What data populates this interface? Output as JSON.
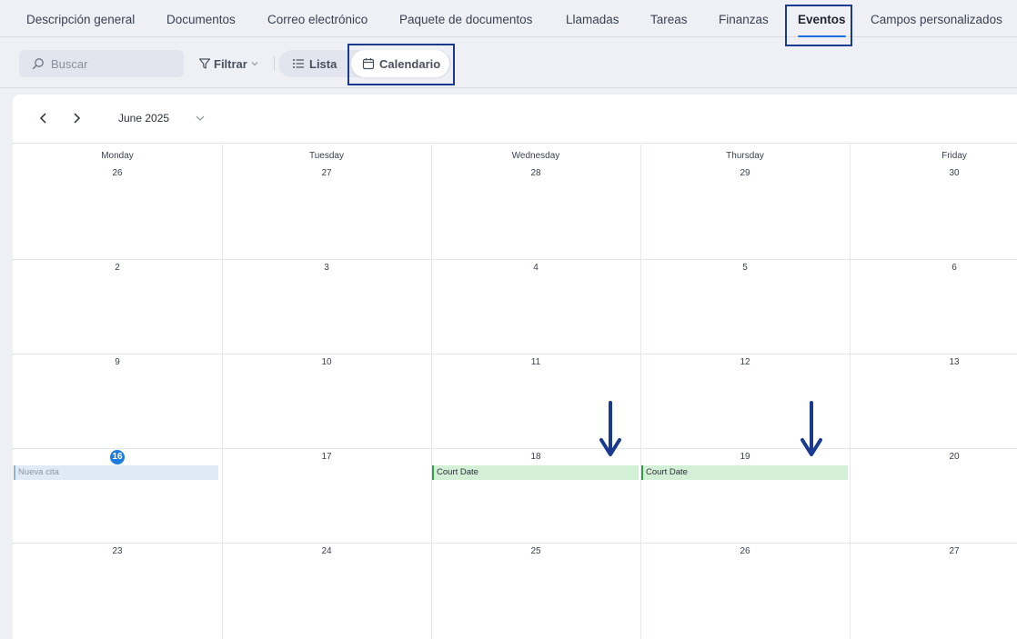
{
  "tabs": [
    {
      "label": "Descripción general",
      "active": false
    },
    {
      "label": "Documentos",
      "active": false
    },
    {
      "label": "Correo electrónico",
      "active": false
    },
    {
      "label": "Paquete de documentos",
      "active": false
    },
    {
      "label": "Llamadas",
      "active": false
    },
    {
      "label": "Tareas",
      "active": false
    },
    {
      "label": "Finanzas",
      "active": false
    },
    {
      "label": "Eventos",
      "active": true
    },
    {
      "label": "Campos personalizados",
      "active": false
    }
  ],
  "toolbar": {
    "search_placeholder": "Buscar",
    "filter_label": "Filtrar",
    "list_label": "Lista",
    "calendar_label": "Calendario"
  },
  "calendar": {
    "month_label": "June 2025",
    "weekdays": [
      "Monday",
      "Tuesday",
      "Wednesday",
      "Thursday",
      "Friday"
    ],
    "weeks": [
      [
        "26",
        "27",
        "28",
        "29",
        "30"
      ],
      [
        "2",
        "3",
        "4",
        "5",
        "6"
      ],
      [
        "9",
        "10",
        "11",
        "12",
        "13"
      ],
      [
        "16",
        "17",
        "18",
        "19",
        "20"
      ],
      [
        "23",
        "24",
        "25",
        "26",
        "27"
      ]
    ],
    "today": "16",
    "events": [
      {
        "label": "Nueva cita",
        "week": 3,
        "day": 0,
        "style": "blue"
      },
      {
        "label": "Court Date",
        "week": 3,
        "day": 2,
        "style": "green"
      },
      {
        "label": "Court Date",
        "week": 3,
        "day": 3,
        "style": "green"
      }
    ]
  },
  "colors": {
    "accent": "#1e6fd9",
    "today": "#1e7be0",
    "highlight_box": "#1a3a8f",
    "event_green": "#d3efd6",
    "event_blue": "#dfeaf6"
  }
}
